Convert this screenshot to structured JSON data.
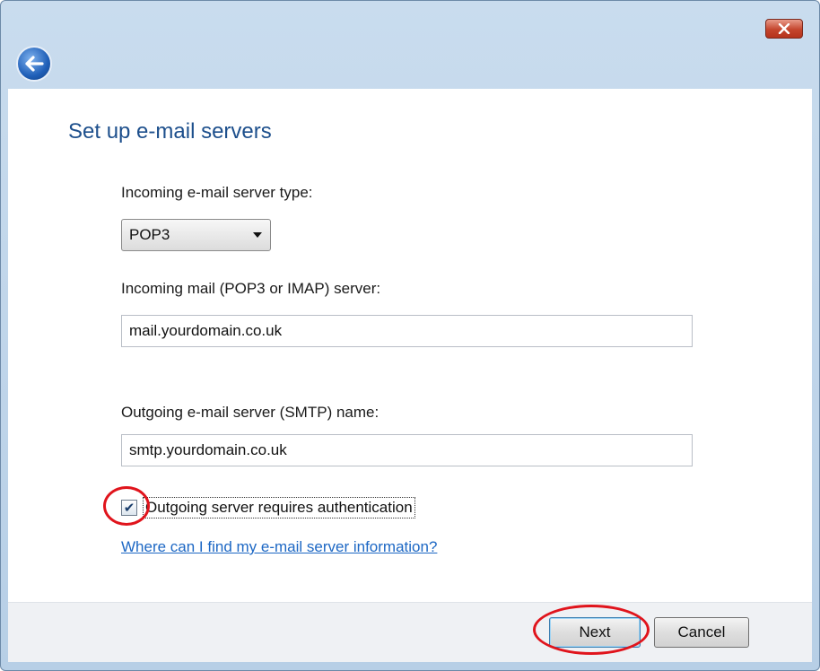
{
  "window": {
    "close_icon": "close-icon",
    "back_icon": "back-arrow-icon"
  },
  "main": {
    "title": "Set up e-mail servers",
    "incoming_type_label": "Incoming e-mail server type:",
    "incoming_type_value": "POP3",
    "incoming_server_label": "Incoming mail (POP3 or IMAP) server:",
    "incoming_server_value": "mail.yourdomain.co.uk",
    "outgoing_server_label": "Outgoing e-mail server (SMTP) name:",
    "outgoing_server_value": "smtp.yourdomain.co.uk",
    "auth_checkbox_checked": true,
    "auth_checkbox_label": "Outgoing server requires authentication",
    "help_link": "Where can I find my e-mail server information?"
  },
  "footer": {
    "next_label": "Next",
    "cancel_label": "Cancel"
  },
  "colors": {
    "title": "#1d4f8c",
    "link": "#1c67c4",
    "annotation": "#e0141c"
  }
}
